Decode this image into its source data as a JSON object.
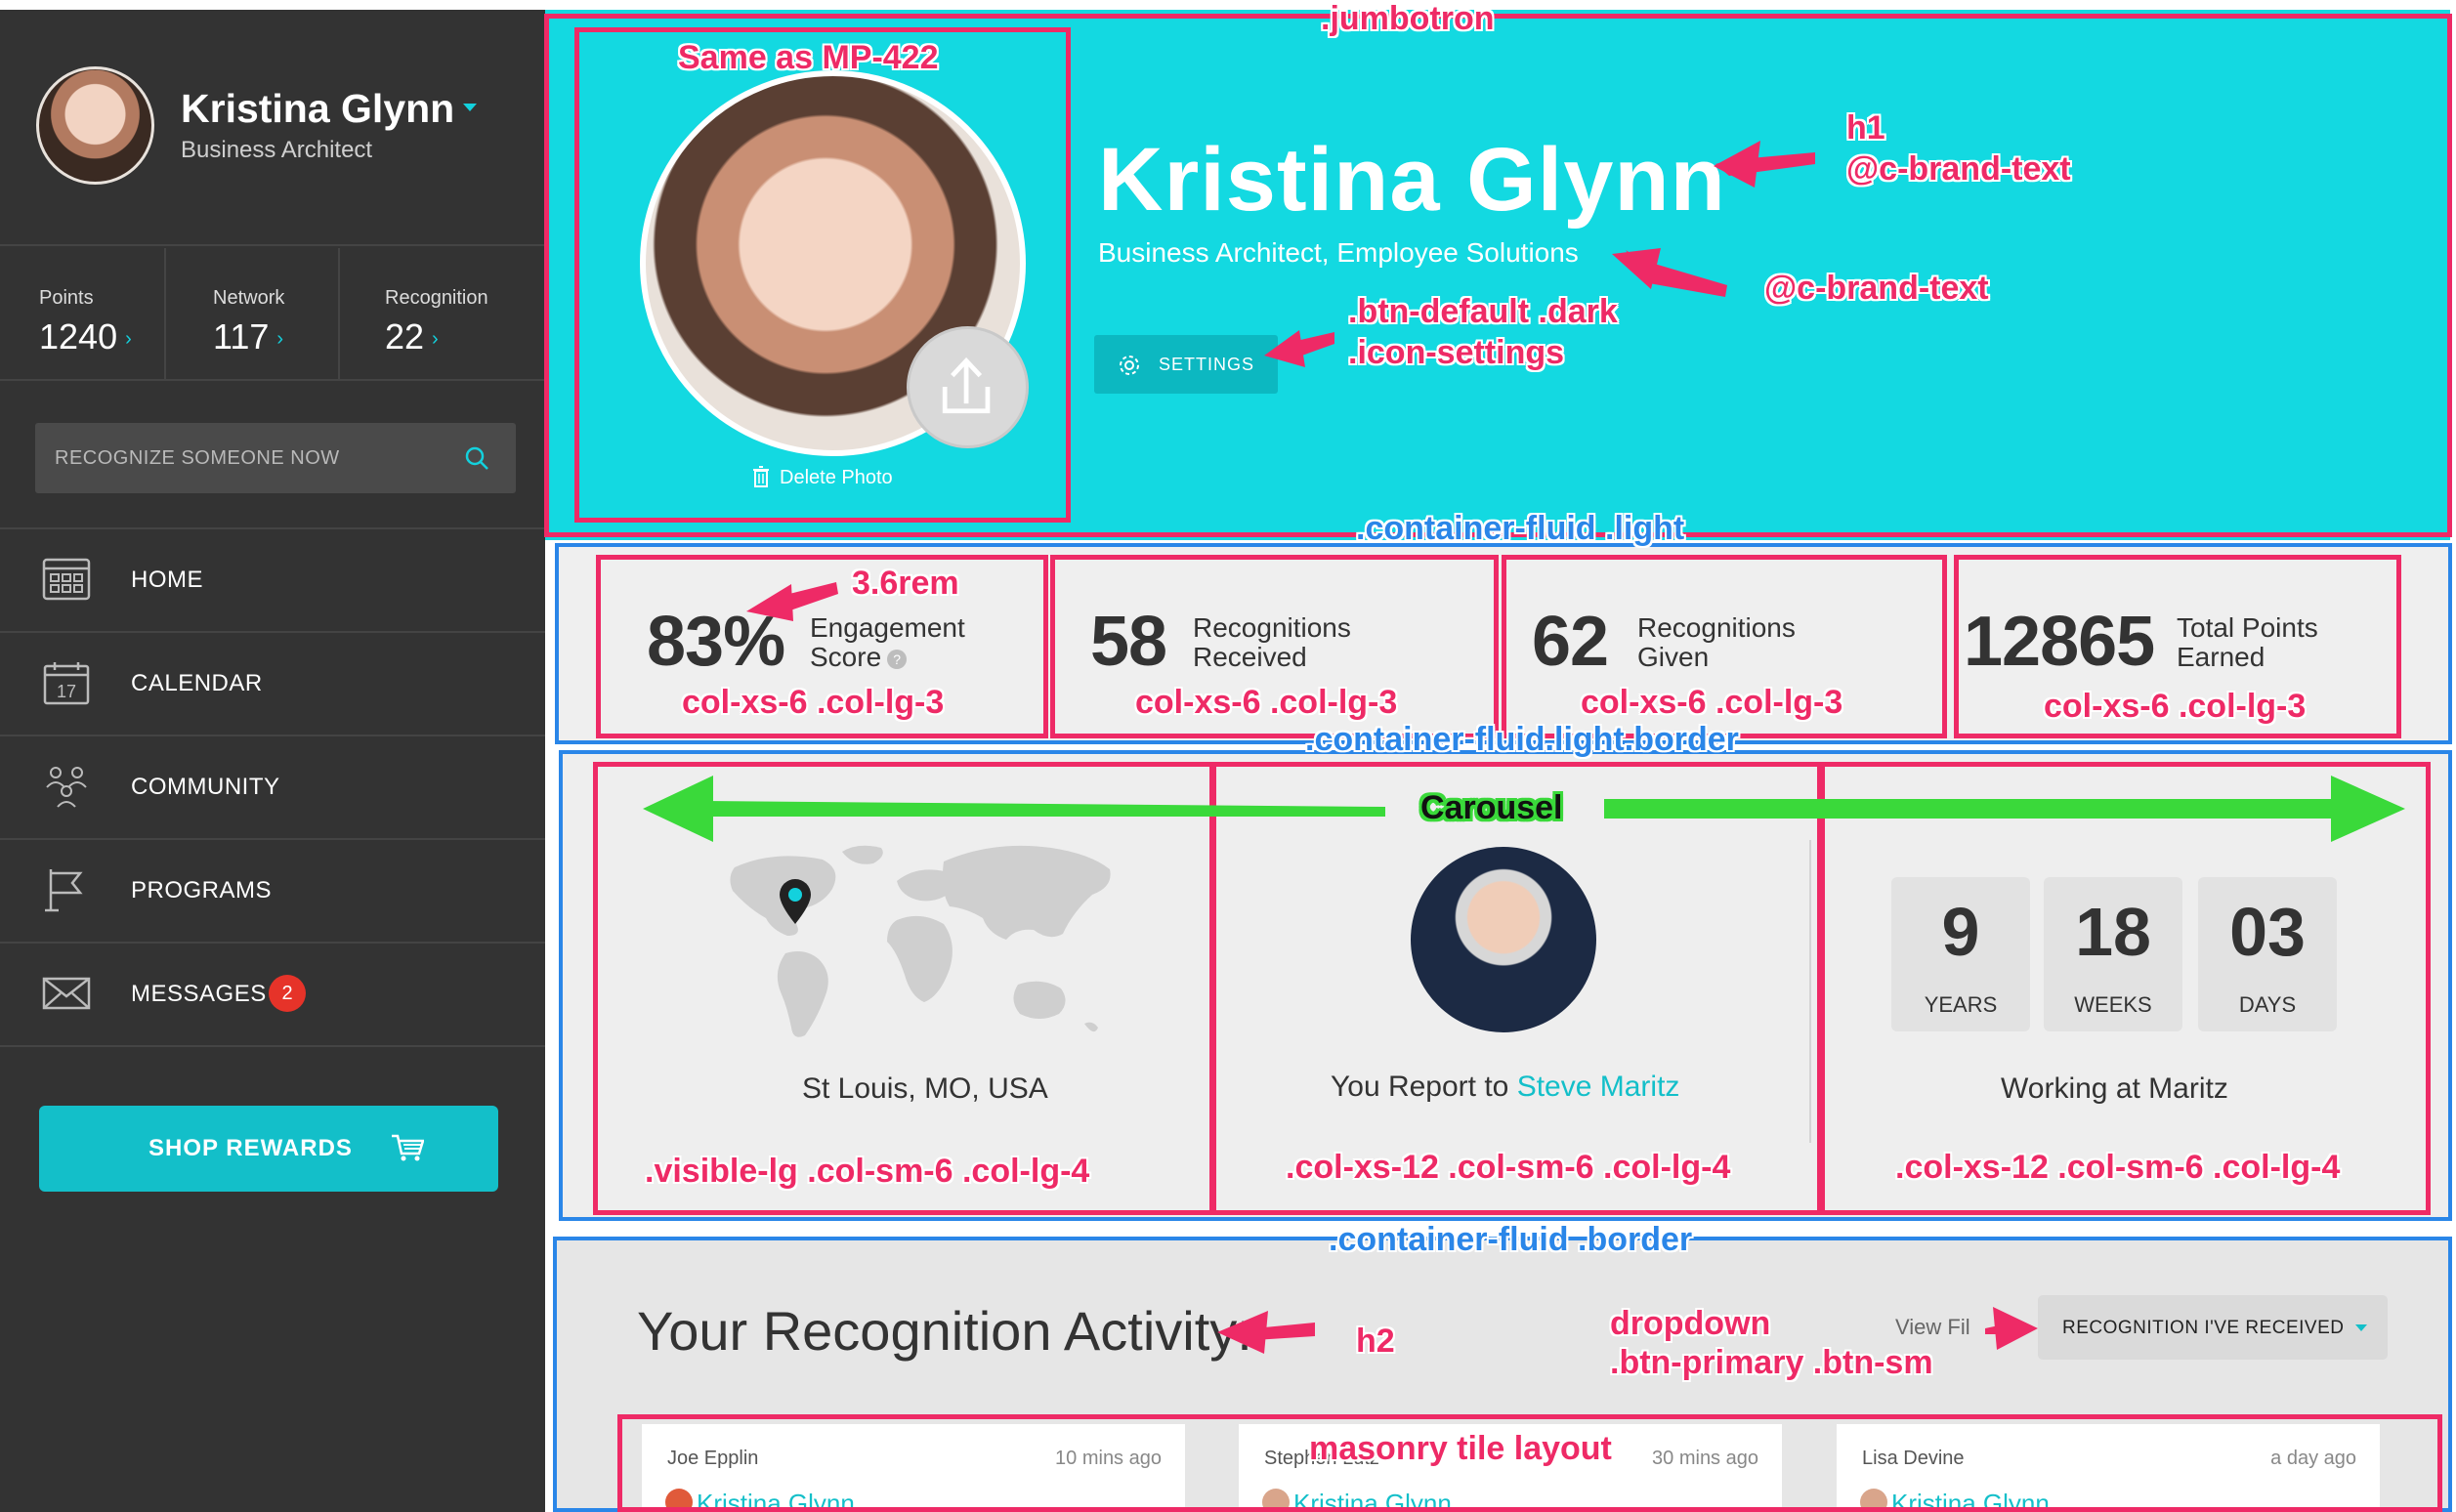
{
  "sidebar": {
    "profile": {
      "name": "Kristina Glynn",
      "role": "Business Architect"
    },
    "stats": [
      {
        "label": "Points",
        "value": "1240"
      },
      {
        "label": "Network",
        "value": "117"
      },
      {
        "label": "Recognition",
        "value": "22"
      }
    ],
    "search": {
      "placeholder": "RECOGNIZE SOMEONE NOW"
    },
    "nav": [
      {
        "label": "HOME",
        "icon": "home-grid-icon"
      },
      {
        "label": "CALENDAR",
        "icon": "calendar-icon",
        "icon_text": "17"
      },
      {
        "label": "COMMUNITY",
        "icon": "community-icon"
      },
      {
        "label": "PROGRAMS",
        "icon": "flag-icon"
      },
      {
        "label": "MESSAGES",
        "icon": "envelope-icon",
        "badge": "2"
      }
    ],
    "shop_button": "SHOP REWARDS"
  },
  "jumbotron": {
    "name": "Kristina Glynn",
    "subtitle": "Business Architect, Employee Solutions",
    "settings_label": "SETTINGS",
    "delete_photo": "Delete Photo"
  },
  "stats_row": [
    {
      "value": "83%",
      "line1": "Engagement",
      "line2": "Score"
    },
    {
      "value": "58",
      "line1": "Recognitions",
      "line2": "Received"
    },
    {
      "value": "62",
      "line1": "Recognitions",
      "line2": "Given"
    },
    {
      "value": "12865",
      "line1": "Total Points",
      "line2": "Earned"
    }
  ],
  "carousel": {
    "location": "St Louis, MO, USA",
    "report_prefix": "You Report to ",
    "manager_name": "Steve Maritz",
    "tenure": [
      {
        "value": "9",
        "label": "YEARS"
      },
      {
        "value": "18",
        "label": "WEEKS"
      },
      {
        "value": "03",
        "label": "DAYS"
      }
    ],
    "tenure_caption": "Working at Maritz"
  },
  "activity": {
    "title": "Your Recognition Activity:",
    "view_filter": "View Fil",
    "dropdown_value": "RECOGNITION I'VE RECEIVED",
    "tiles": [
      {
        "from": "Joe Epplin",
        "time": "10 mins ago",
        "to": "Kristina Glynn"
      },
      {
        "from": "Stephen Lutz",
        "time": "30 mins ago",
        "to": "Kristina Glynn"
      },
      {
        "from": "Lisa Devine",
        "time": "a day ago",
        "to": "Kristina Glynn"
      }
    ]
  },
  "annotations": {
    "jumbotron": ".jumbotron",
    "same_as": "Same as MP-422",
    "h1_tag": "h1",
    "h1_color": "@c-brand-text",
    "subtitle_color": "@c-brand-text",
    "btn_class1": ".btn-default .dark",
    "btn_class2": ".icon-settings",
    "container_light": ".container-fluid .light",
    "rem": "3.6rem",
    "col1": "col-xs-6 .col-lg-3",
    "col2": "col-xs-6 .col-lg-3",
    "col3": "col-xs-6 .col-lg-3",
    "col4": "col-xs-6 .col-lg-3",
    "container_light_border": ".container-fluid.light.border",
    "carousel": "Carousel",
    "car_col1": ".visible-lg .col-sm-6 .col-lg-4",
    "car_col2": ".col-xs-12 .col-sm-6 .col-lg-4",
    "car_col3": ".col-xs-12 .col-sm-6 .col-lg-4",
    "container_border": ".container-fluid .border",
    "h2_tag": "h2",
    "dropdown1": "dropdown",
    "dropdown2": ".btn-primary .btn-sm",
    "masonry": "masonry tile layout"
  },
  "colors": {
    "brand": "#13d9e1",
    "sidebar": "#333333",
    "annotation_pink": "#ee2a66",
    "annotation_blue": "#2a86e8",
    "annotation_green": "#3ad93a",
    "badge": "#e63329"
  }
}
